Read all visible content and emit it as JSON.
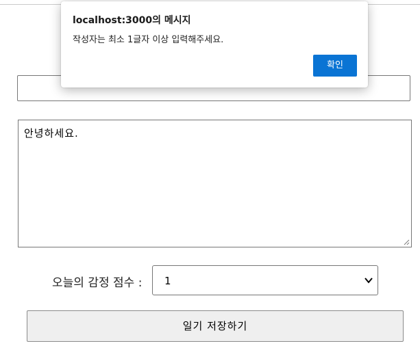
{
  "dialog": {
    "title": "localhost:3000의 메시지",
    "message": "작성자는 최소 1글자 이상 입력해주세요.",
    "ok_label": "확인"
  },
  "form": {
    "author_value": "",
    "content_value": "안녕하세요.",
    "emotion_label": "오늘의 감정 점수 :",
    "emotion_selected": "1",
    "save_label": "일기 저장하기"
  },
  "colors": {
    "accent": "#0a74d4",
    "button_bg": "#efefef"
  }
}
